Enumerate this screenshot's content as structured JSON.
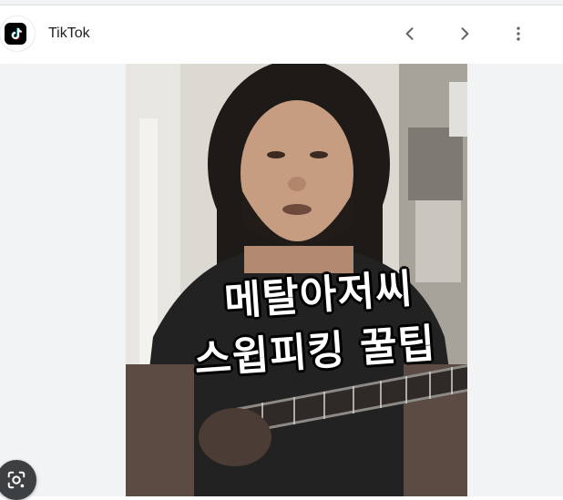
{
  "header": {
    "site_name": "TikTok",
    "favicon_icon": "tiktok-logo-icon",
    "prev_icon": "chevron-left-icon",
    "next_icon": "chevron-right-icon",
    "more_icon": "more-vert-icon"
  },
  "preview": {
    "caption_line1": "메탈아저씨",
    "caption_line2": "스윕피킹 꿀팁"
  },
  "lens": {
    "icon": "google-lens-icon"
  },
  "colors": {
    "viewer_background": "#f1f3f4",
    "caption_text": "#ffffff",
    "caption_outline": "#000000"
  }
}
